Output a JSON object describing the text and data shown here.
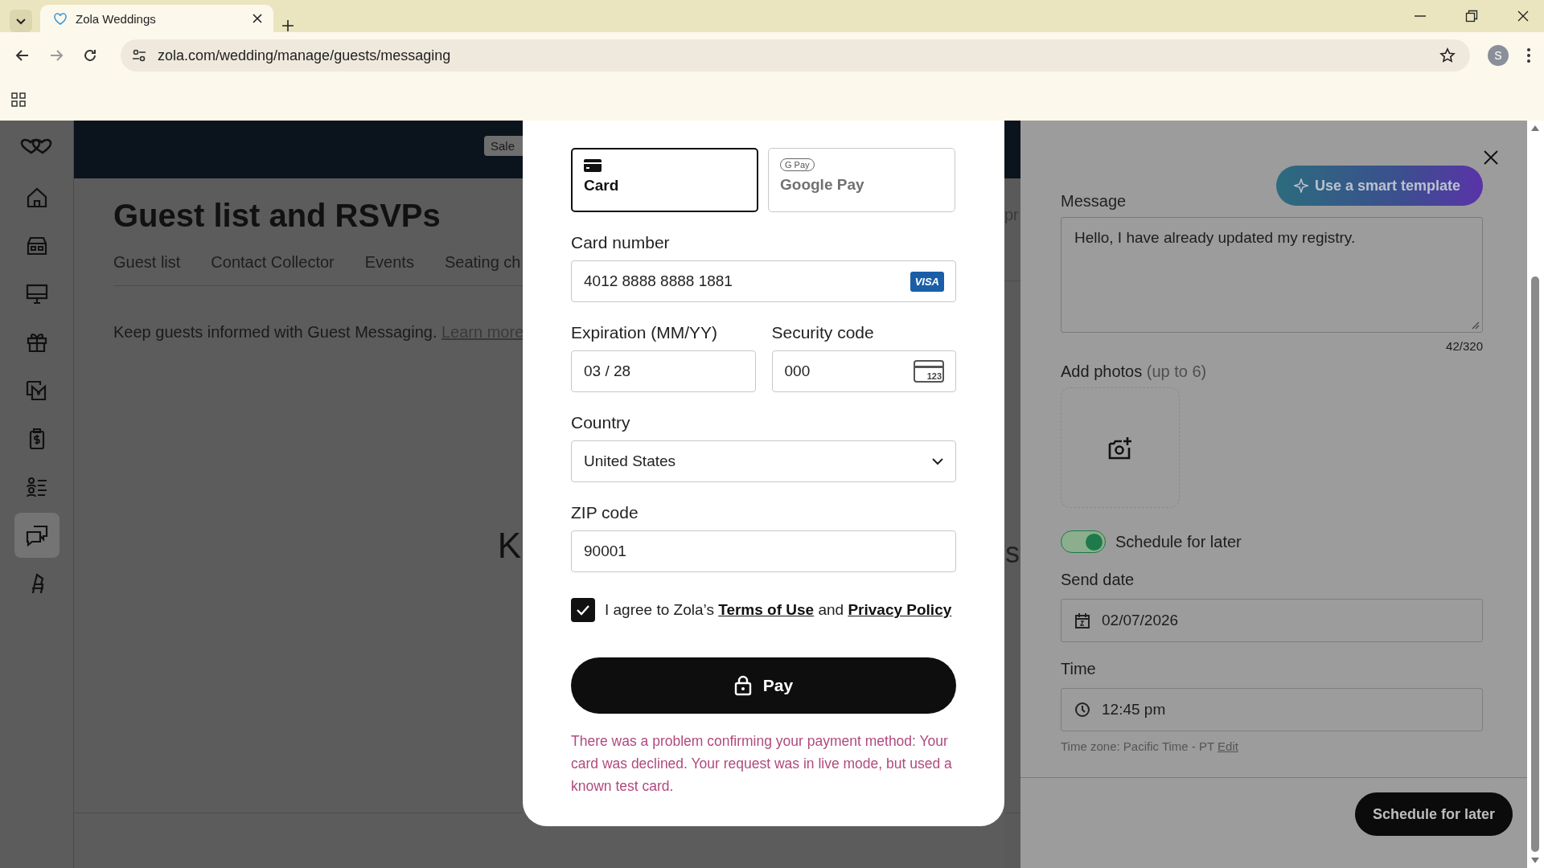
{
  "browser": {
    "tabs": [
      {
        "title": "Zola Weddings",
        "selected": true
      }
    ],
    "url": "zola.com/wedding/manage/guests/messaging",
    "profile_initial": "S"
  },
  "sidebar": {
    "items": [
      {
        "kind": "home",
        "selected": false
      },
      {
        "kind": "store",
        "selected": false
      },
      {
        "kind": "monitor",
        "selected": false
      },
      {
        "kind": "gift",
        "selected": false
      },
      {
        "kind": "envelope",
        "selected": false
      },
      {
        "kind": "cash",
        "selected": false
      },
      {
        "kind": "guests",
        "selected": false
      },
      {
        "kind": "messages",
        "selected": true
      },
      {
        "kind": "chair",
        "selected": false
      }
    ]
  },
  "main": {
    "badge": "Sale",
    "title": "Guest list and RSVPs",
    "tabs": [
      "Guest list",
      "Contact Collector",
      "Events",
      "Seating ch"
    ],
    "intro": "Keep guests informed with Guest Messaging.",
    "intro_link": "Learn more",
    "fragment": "K"
  },
  "strip": {
    "fragments": [
      "pr",
      "s"
    ]
  },
  "modal": {
    "methods": [
      {
        "kind": "card",
        "label": "Card",
        "selected": true
      },
      {
        "kind": "gpay",
        "label": "Google Pay",
        "badge": "G Pay",
        "selected": false
      }
    ],
    "card_number": {
      "label": "Card number",
      "value": "4012 8888 8888 1881",
      "brand": "VISA"
    },
    "expiration": {
      "label": "Expiration (MM/YY)",
      "value": "03 / 28"
    },
    "security_code": {
      "label": "Security code",
      "value": "000",
      "hint": "123"
    },
    "country": {
      "label": "Country",
      "value": "United States"
    },
    "zip": {
      "label": "ZIP code",
      "value": "90001"
    },
    "consent": {
      "checked": true,
      "text": "I agree to Zola’s",
      "link_1": "Terms of Use",
      "joiner": "and",
      "link_2": "Privacy Policy"
    },
    "pay_button": "Pay",
    "error": "There was a problem confirming your payment method: Your card was declined. Your request was in live mode, but used a known test card."
  },
  "panel": {
    "smart_template": "Use a smart template",
    "message_label": "Message",
    "message": "Hello, I have already updated my registry.",
    "counter": "42/320",
    "photos_label": "Add photos",
    "photos_hint": "(up to 6)",
    "schedule": {
      "label": "Schedule for later",
      "on": true
    },
    "send_date": {
      "label": "Send date",
      "value": "02/07/2026"
    },
    "time": {
      "label": "Time",
      "value": "12:45 pm"
    },
    "timezone": "Time zone: Pacific Time - PT",
    "timezone_link": "Edit",
    "submit": "Schedule for later"
  }
}
